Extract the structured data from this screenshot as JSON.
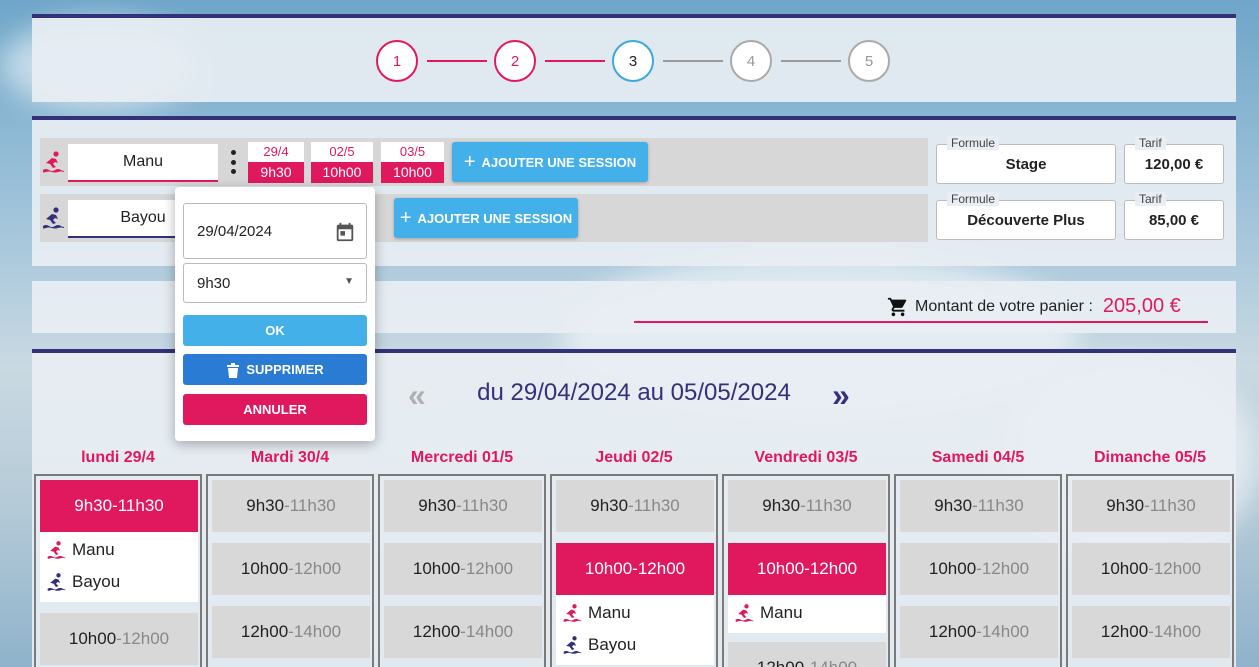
{
  "stepper": {
    "steps": [
      "1",
      "2",
      "3",
      "4",
      "5"
    ]
  },
  "participants": [
    {
      "name": "Manu",
      "icon": "surfer-icon",
      "color": "#e0195f",
      "sessions": [
        {
          "date": "29/4",
          "time": "9h30"
        },
        {
          "date": "02/5",
          "time": "10h00"
        },
        {
          "date": "03/5",
          "time": "10h00"
        }
      ],
      "add_label": "AJOUTER UNE SESSION",
      "formule_label": "Formule",
      "formule": "Stage",
      "tarif_label": "Tarif",
      "tarif": "120,00 €"
    },
    {
      "name": "Bayou",
      "icon": "surfer-icon",
      "color": "#33317a",
      "add_label": "AJOUTER UNE SESSION",
      "formule_label": "Formule",
      "formule": "Découverte Plus",
      "tarif_label": "Tarif",
      "tarif": "85,00 €"
    }
  ],
  "popup": {
    "date_value": "29/04/2024",
    "time_value": "9h30",
    "ok_label": "OK",
    "delete_label": "SUPPRIMER",
    "cancel_label": "ANNULER"
  },
  "cart": {
    "label": "Montant de votre panier :",
    "amount": "205,00 €"
  },
  "calendar": {
    "week_label": "du 29/04/2024 au 05/05/2024",
    "days": [
      {
        "label": "lundi 29/4"
      },
      {
        "label": "Mardi 30/4"
      },
      {
        "label": "Mercredi 01/5"
      },
      {
        "label": "Jeudi 02/5"
      },
      {
        "label": "Vendredi 03/5"
      },
      {
        "label": "Samedi 04/5"
      },
      {
        "label": "Dimanche 05/5"
      }
    ],
    "slots": {
      "s1": {
        "start": "9h30",
        "sep": " - ",
        "end": "11h30"
      },
      "s2": {
        "start": "10h00",
        "sep": " - ",
        "end": "12h00"
      },
      "s3": {
        "start": "12h00",
        "sep": " - ",
        "end": "14h00"
      }
    }
  },
  "colors": {
    "pink": "#e0195f",
    "navy": "#33317a",
    "blue": "#43b0ea",
    "darkblue": "#2a7bd4"
  }
}
